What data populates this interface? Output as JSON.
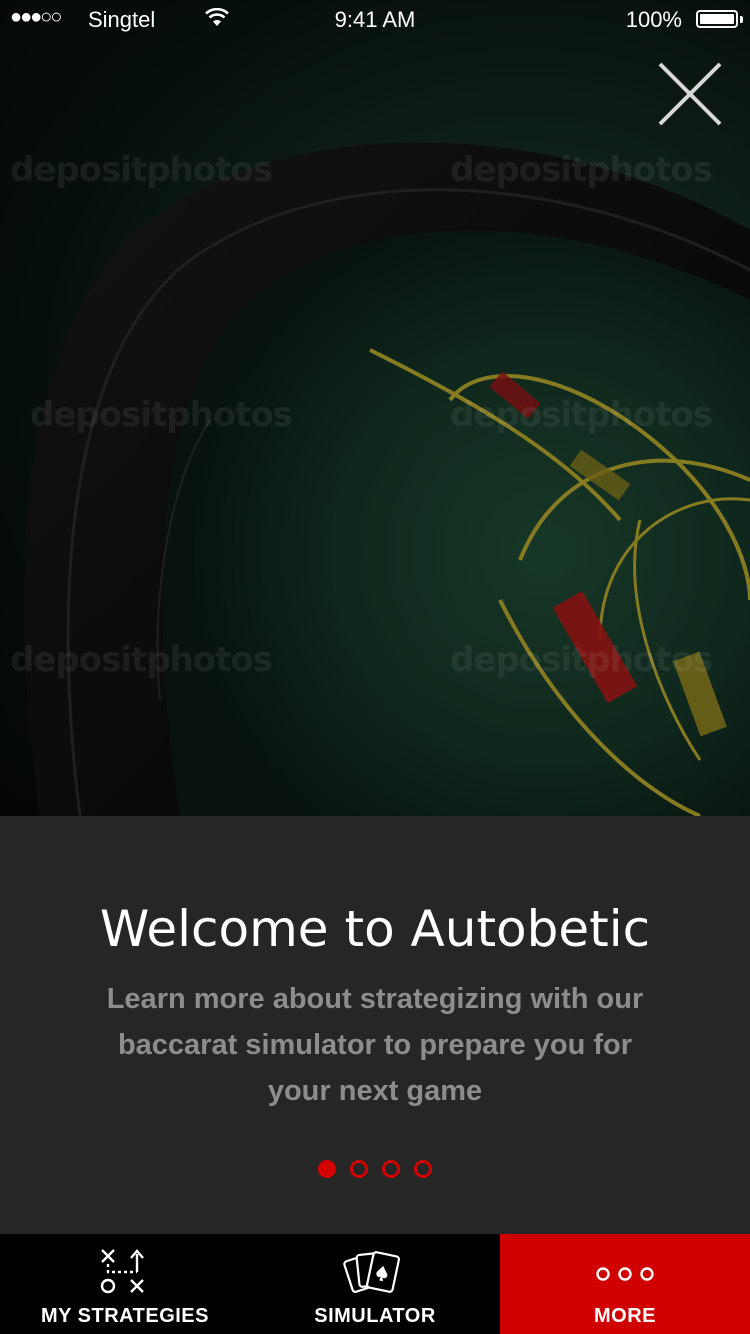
{
  "status_bar": {
    "signal": "●●●○○",
    "carrier": "Singtel",
    "time": "9:41 AM",
    "battery": "100%"
  },
  "hero": {
    "watermark_text": "depositphotos"
  },
  "onboarding": {
    "title": "Welcome to Autobetic",
    "subtitle": "Learn more about strategizing with our baccarat simulator to prepare you for your next game",
    "page_count": 4,
    "active_page": 1
  },
  "tabs": [
    {
      "label": "MY STRATEGIES",
      "icon": "strategy-play-icon",
      "selected": false
    },
    {
      "label": "SIMULATOR",
      "icon": "playing-cards-icon",
      "selected": false
    },
    {
      "label": "MORE",
      "icon": "more-dots-icon",
      "selected": true
    }
  ],
  "colors": {
    "accent": "#d00000",
    "panel_bg": "#262626",
    "tab_bg": "#000000",
    "subtitle": "#8d8d8d"
  }
}
